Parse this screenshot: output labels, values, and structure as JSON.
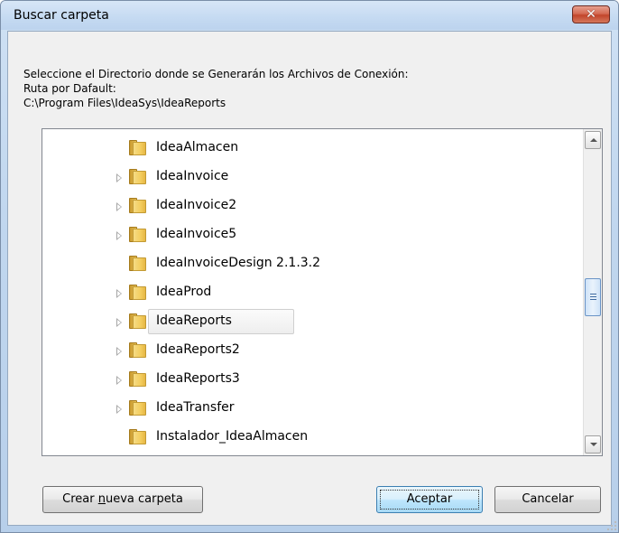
{
  "window": {
    "title": "Buscar carpeta",
    "close_glyph": "✕"
  },
  "description": {
    "line1": "Seleccione el Directorio donde se Generarán los Archivos de Conexión:",
    "line2": "Ruta por Dafault:",
    "line3": "C:\\Program Files\\IdeaSys\\IdeaReports"
  },
  "tree": {
    "items": [
      {
        "label": "IdeaAlmacen",
        "expandable": false,
        "selected": false
      },
      {
        "label": "IdeaInvoice",
        "expandable": true,
        "selected": false
      },
      {
        "label": "IdeaInvoice2",
        "expandable": true,
        "selected": false
      },
      {
        "label": "IdeaInvoice5",
        "expandable": true,
        "selected": false
      },
      {
        "label": "IdeaInvoiceDesign 2.1.3.2",
        "expandable": false,
        "selected": false
      },
      {
        "label": "IdeaProd",
        "expandable": true,
        "selected": false
      },
      {
        "label": "IdeaReports",
        "expandable": true,
        "selected": true
      },
      {
        "label": "IdeaReports2",
        "expandable": true,
        "selected": false
      },
      {
        "label": "IdeaReports3",
        "expandable": true,
        "selected": false
      },
      {
        "label": "IdeaTransfer",
        "expandable": true,
        "selected": false
      },
      {
        "label": "Instalador_IdeaAlmacen",
        "expandable": false,
        "selected": false
      }
    ]
  },
  "buttons": {
    "new_folder_pre": "Crear ",
    "new_folder_accel": "n",
    "new_folder_post": "ueva carpeta",
    "ok": "Aceptar",
    "cancel": "Cancelar"
  },
  "icons": {
    "folder": "folder-icon",
    "expander": "expander-triangle-icon",
    "close": "close-icon"
  },
  "colors": {
    "close_button": "#c7482d",
    "default_button_border": "#3c7fb1",
    "scroll_thumb": "#cfe3f8",
    "selection_border": "#cfcfcf"
  }
}
